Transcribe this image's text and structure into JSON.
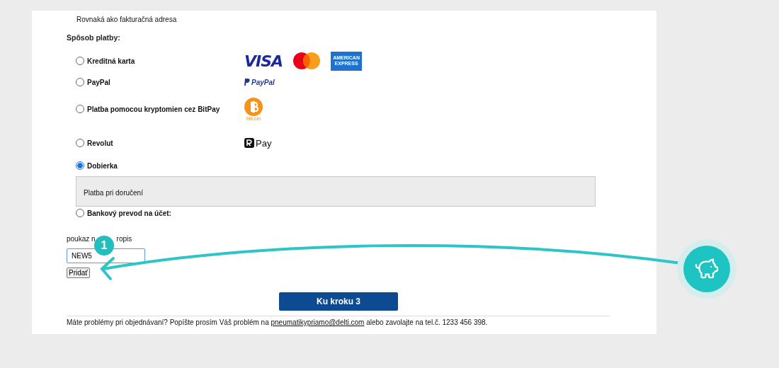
{
  "delivery_address_note": "Rovnaká ako fakturačná adresa",
  "payment": {
    "heading": "Spôsob platby:",
    "options": [
      {
        "label": "Kreditná karta",
        "selected": false,
        "logos": [
          {
            "kind": "visa",
            "text": "VISA"
          },
          {
            "kind": "mastercard"
          },
          {
            "kind": "amex",
            "text": "AMERICAN EXPRESS"
          }
        ]
      },
      {
        "label": "PayPal",
        "selected": false,
        "logos": [
          {
            "kind": "paypal",
            "text": "PayPal"
          }
        ]
      },
      {
        "label": "Platba pomocou kryptomien cez BitPay",
        "selected": false,
        "logos": [
          {
            "kind": "bitcoin",
            "text": "bitcoin"
          }
        ]
      },
      {
        "label": "Revolut",
        "selected": false,
        "logos": [
          {
            "kind": "rpay",
            "text": "Pay"
          }
        ]
      },
      {
        "label": "Dobierka",
        "selected": true,
        "detail": "Platba pri doručení"
      },
      {
        "label": "Bankový prevod na účet:",
        "selected": false
      }
    ]
  },
  "voucher": {
    "label_start": "poukaz n",
    "label_end": "ropis",
    "value": "NEW5",
    "button": "Pridať"
  },
  "next_button": "Ku kroku 3",
  "footer": {
    "before": "Máte problémy pri objednávaní? Popíšte prosím Váš problém na ",
    "email": "pneumatikypriamo@delti.com",
    "after": " alebo zavolajte na tel.č. 1233 456 398."
  },
  "callout": {
    "badge": "1"
  }
}
